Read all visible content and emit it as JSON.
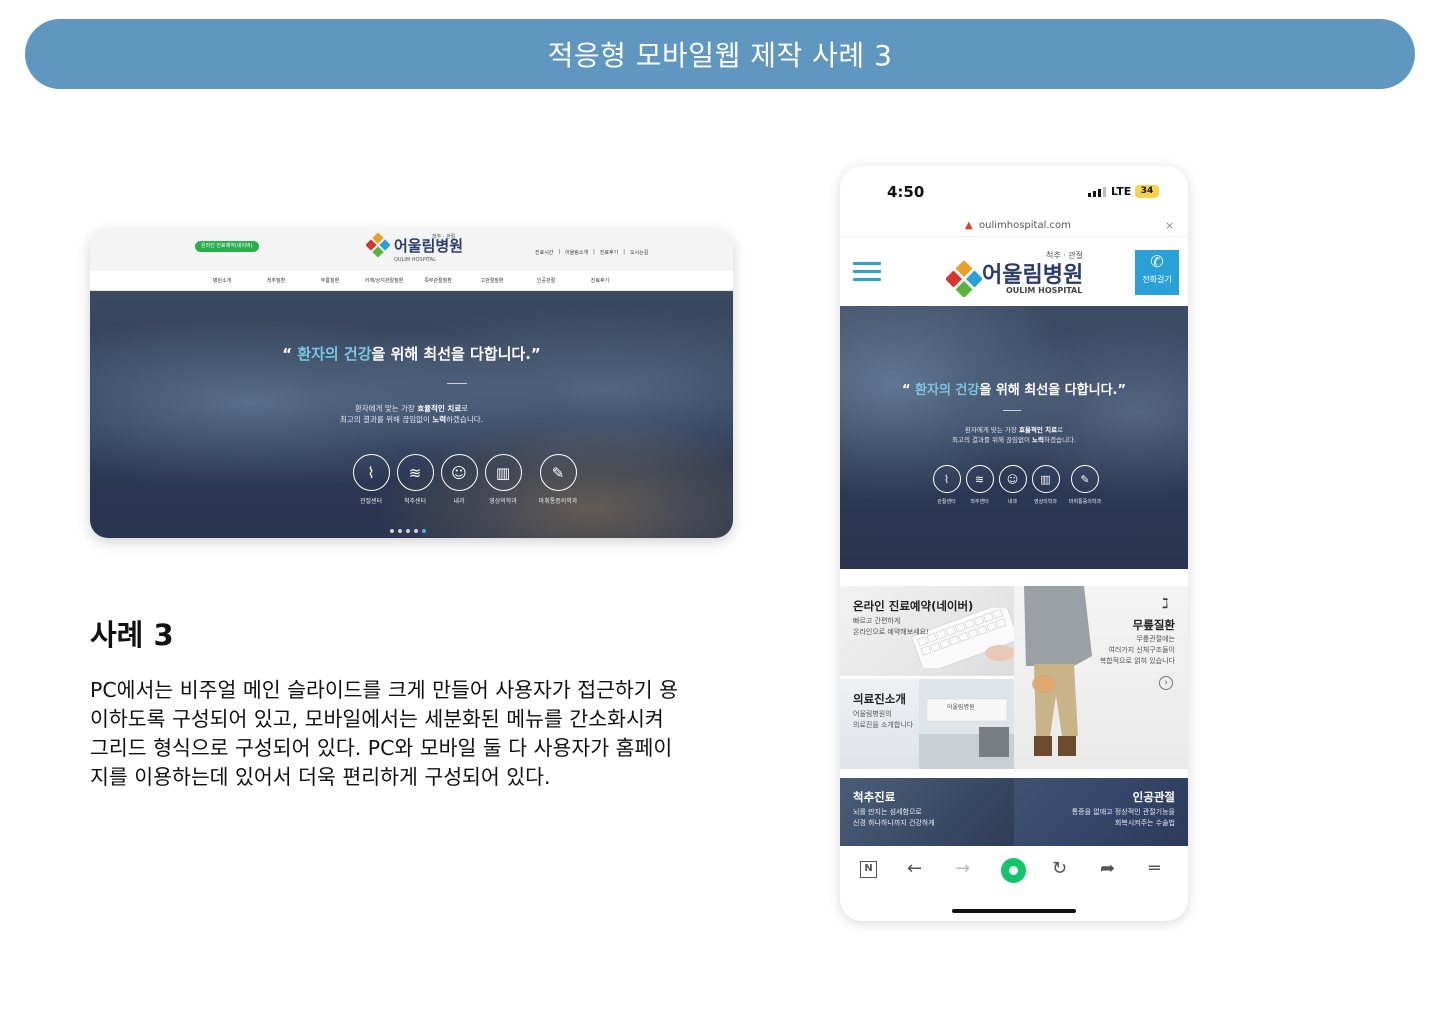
{
  "banner": {
    "title": "적응형 모바일웹 제작 사례 3"
  },
  "pc": {
    "reserve_pill": "온라인 진료예약(네이버)",
    "logo": {
      "tagline": "척추 · 관절",
      "name": "어울림병원",
      "en": "OULIM HOSPITAL"
    },
    "top_links": [
      "진료시간",
      "어울림소개",
      "진료후기",
      "오시는길"
    ],
    "nav": [
      "병원소개",
      "척추질환",
      "무릎질환",
      "어깨/상지관절질환",
      "족부관절질환",
      "고관절질환",
      "인공관절",
      "진료후기"
    ],
    "hero": {
      "quote_open": "“",
      "quote_hl": "환자의 건강",
      "quote_rest": "을 위해 최선을 다합니다.",
      "quote_close": "”",
      "sub1_a": "환자에게 맞는 가장 ",
      "sub1_b": "효율적인 치료",
      "sub1_c": "로",
      "sub2_a": "최고의 결과를 위해 끊임없이 ",
      "sub2_b": "노력",
      "sub2_c": "하겠습니다.",
      "icons": [
        {
          "label": "관절센터",
          "icon": "knee-icon"
        },
        {
          "label": "척추센터",
          "icon": "spine-icon"
        },
        {
          "label": "내과",
          "icon": "doctor-icon"
        },
        {
          "label": "영상의학과",
          "icon": "xray-icon"
        },
        {
          "label": "마취통증의학과",
          "icon": "syringe-icon"
        }
      ],
      "slides_total": 5,
      "slides_active": 5
    }
  },
  "case": {
    "title": "사례 3",
    "desc_lines": [
      "PC에서는 비주얼 메인 슬라이드를 크게 만들어 사용자가 접근하기 용",
      "이하도록 구성되어 있고, 모바일에서는 세분화된 메뉴를 간소화시켜",
      "그리드 형식으로 구성되어 있다. PC와 모바일 둘 다 사용자가 홈페이",
      "지를 이용하는데 있어서 더욱 편리하게 구성되어 있다."
    ]
  },
  "phone": {
    "time": "4:50",
    "network": "LTE",
    "battery": "34",
    "url": "oulimhospital.com",
    "close": "×",
    "logo": {
      "tagline": "척추 · 관절",
      "name": "어울림병원",
      "en": "OULIM HOSPITAL"
    },
    "call_label": "전화걸기",
    "hero": {
      "quote_open": "“",
      "quote_hl": "환자의 건강",
      "quote_rest": "을 위해 최선을 다합니다.",
      "quote_close": "”",
      "sub1_a": "환자에게 맞는 가장 ",
      "sub1_b": "효율적인 치료",
      "sub1_c": "로",
      "sub2_a": "최고의 결과를 위해 끊임없이 ",
      "sub2_b": "노력",
      "sub2_c": "하겠습니다.",
      "icons": [
        {
          "label": "관절센터"
        },
        {
          "label": "척추센터"
        },
        {
          "label": "내과"
        },
        {
          "label": "영상의학과"
        },
        {
          "label": "마취통증의학과"
        }
      ]
    },
    "tiles": {
      "reserve": {
        "title": "온라인 진료예약(네이버)",
        "d1": "빠르고 간편하게",
        "d2": "온라인으로 예약해보세요!"
      },
      "knee": {
        "title": "무릎질환",
        "d1": "무릎관절에는",
        "d2": "여러가지 신체구조들이",
        "d3": "복합적으로 얽혀 있습니다"
      },
      "intro": {
        "title": "의료진소개",
        "d1": "어울림병원의",
        "d2": "의료진을 소개합니다",
        "sign": "어울림병원"
      },
      "spine": {
        "title": "척추진료",
        "d1": "뇌를 만지는 섬세함으로",
        "d2": "신경 하나하나까지 건강하게"
      },
      "joint": {
        "title": "인공관절",
        "d1": "통증을 없애고 정상적인 관절기능을",
        "d2": "회복시켜주는 수술법"
      }
    },
    "toolbar": {
      "n_label": "N"
    }
  },
  "colors": {
    "banner": "#5f97c0",
    "accent": "#2aa0d8",
    "highlight": "#7ac5e0",
    "green": "#12c56a"
  }
}
